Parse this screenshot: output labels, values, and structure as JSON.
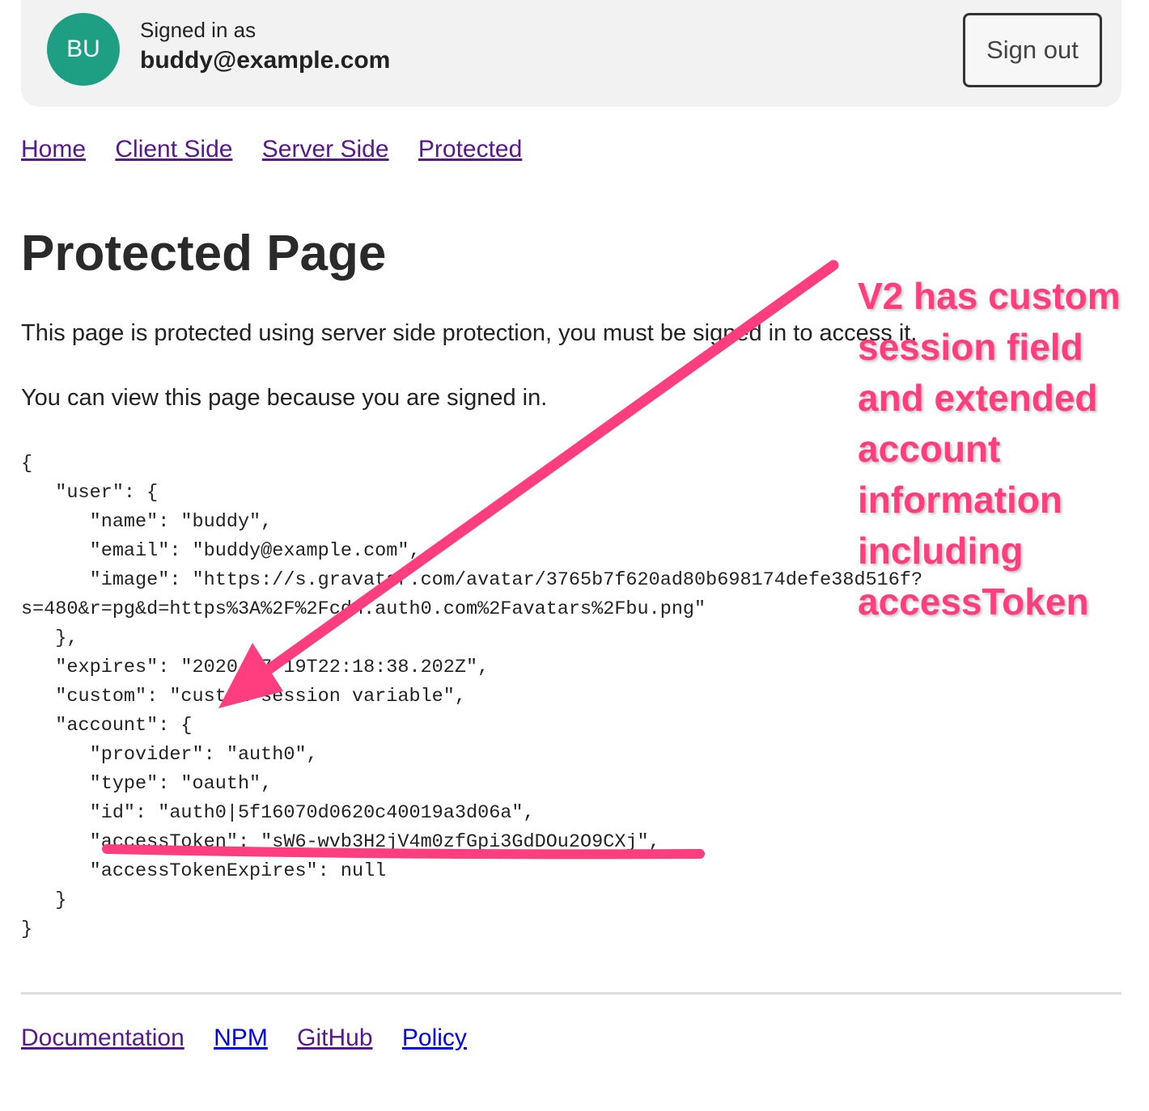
{
  "header": {
    "avatar_initials": "BU",
    "signed_in_label": "Signed in as",
    "email": "buddy@example.com",
    "sign_out_label": "Sign out"
  },
  "nav": {
    "items": [
      "Home",
      "Client Side",
      "Server Side",
      "Protected"
    ]
  },
  "main": {
    "title": "Protected Page",
    "paragraph1": "This page is protected using server side protection, you must be signed in to access it.",
    "paragraph2": "You can view this page because you are signed in.",
    "session_json": "{\n   \"user\": {\n      \"name\": \"buddy\",\n      \"email\": \"buddy@example.com\",\n      \"image\": \"https://s.gravatar.com/avatar/3765b7f620ad80b698174defe38d516f?\ns=480&r=pg&d=https%3A%2F%2Fcdn.auth0.com%2Favatars%2Fbu.png\"\n   },\n   \"expires\": \"2020-07-19T22:18:38.202Z\",\n   \"custom\": \"custom session variable\",\n   \"account\": {\n      \"provider\": \"auth0\",\n      \"type\": \"oauth\",\n      \"id\": \"auth0|5f16070d0620c40019a3d06a\",\n      \"accessToken\": \"sW6-wvb3H2jV4m0zfGpi3GdDOu2O9CXj\",\n      \"accessTokenExpires\": null\n   }\n}"
  },
  "footer": {
    "items": [
      "Documentation",
      "NPM",
      "GitHub",
      "Policy"
    ]
  },
  "annotation": {
    "text": "V2 has custom session field and extended account information including accessToken"
  },
  "colors": {
    "avatar": "#1e9e82",
    "annotation": "#ff3d7f",
    "visited_link": "#551a8b",
    "link": "#0000ee"
  }
}
